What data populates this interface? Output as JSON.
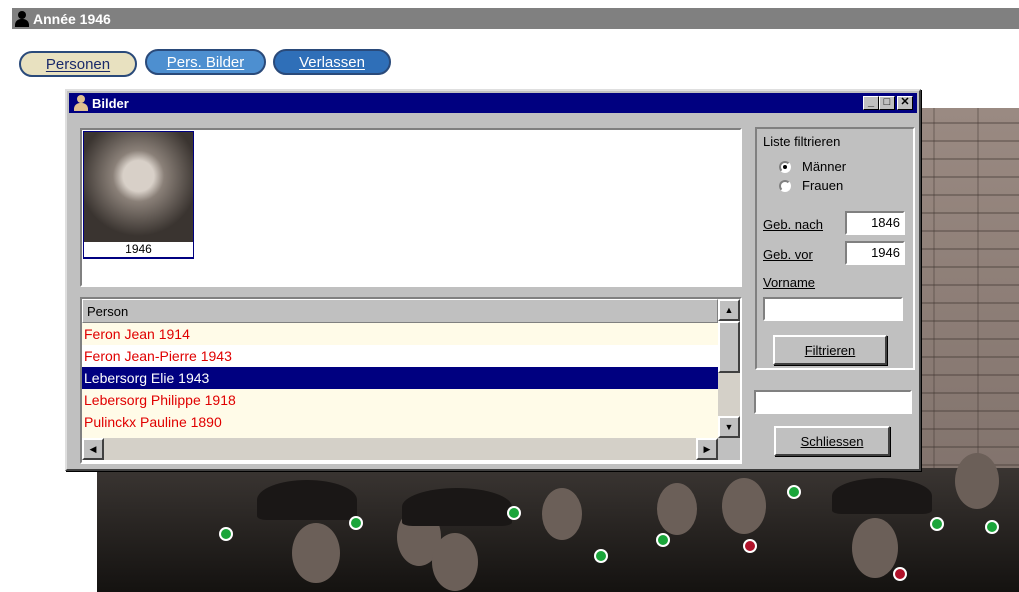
{
  "window": {
    "title": "Année 1946"
  },
  "toolbar": {
    "personen_label": "Personen",
    "bilder_label": "Pers. Bilder",
    "verlassen_label": "Verlassen"
  },
  "dialog": {
    "title": "Bilder",
    "thumbnail": {
      "caption": "1946"
    },
    "list": {
      "header": "Person",
      "rows": [
        "Feron Jean 1914",
        "Feron Jean-Pierre 1943",
        "Lebersorg Elie 1943",
        "Lebersorg Philippe 1918",
        "Pulinckx Pauline 1890"
      ],
      "selected_index": 2
    },
    "filter": {
      "title": "Liste filtrieren",
      "radio_men": "Männer",
      "radio_women": "Frauen",
      "selected": "Männer",
      "born_after_label": "Geb. nach",
      "born_after_value": "1846",
      "born_before_label": "Geb. vor",
      "born_before_value": "1946",
      "firstname_label": "Vorname",
      "firstname_value": "",
      "filter_button": "Filtrieren",
      "status_value": ""
    },
    "close_button": "Schliessen"
  },
  "colors": {
    "title_active": "#000080",
    "title_inactive": "#808080",
    "row_text": "#e00000",
    "marker_green": "#1aa53a",
    "marker_red": "#b0122a"
  }
}
